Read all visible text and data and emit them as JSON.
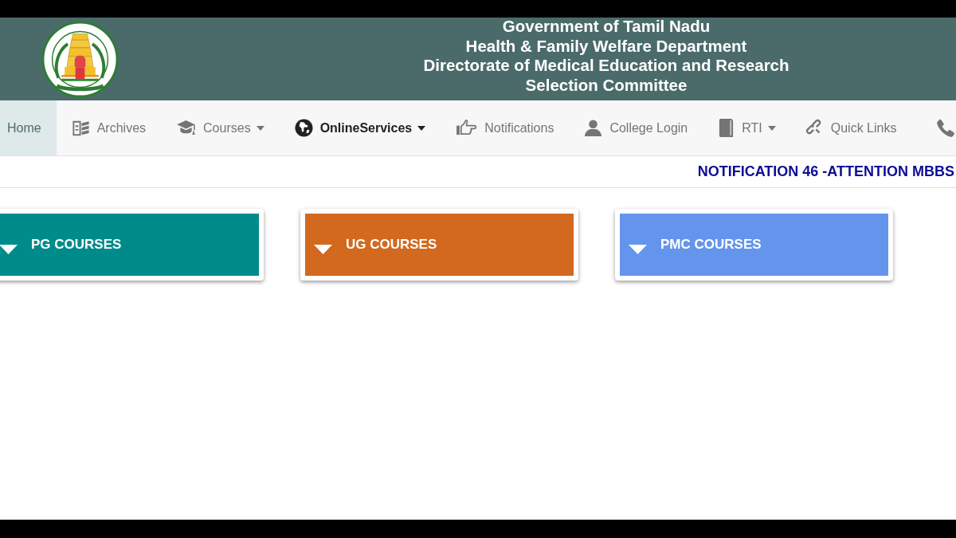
{
  "header": {
    "title_lines": [
      "Government of Tamil Nadu",
      "Health & Family Welfare Department",
      "Directorate of Medical Education and Research",
      "Selection Committee"
    ]
  },
  "nav": {
    "items": [
      {
        "label": "Home",
        "selected": true,
        "highlighted": false,
        "dropdown": false
      },
      {
        "label": "Archives",
        "selected": false,
        "highlighted": false,
        "dropdown": false
      },
      {
        "label": "Courses",
        "selected": false,
        "highlighted": false,
        "dropdown": true
      },
      {
        "label": "OnlineServices",
        "selected": false,
        "highlighted": true,
        "dropdown": true
      },
      {
        "label": "Notifications",
        "selected": false,
        "highlighted": false,
        "dropdown": false
      },
      {
        "label": "College Login",
        "selected": false,
        "highlighted": false,
        "dropdown": false
      },
      {
        "label": "RTI",
        "selected": false,
        "highlighted": false,
        "dropdown": true
      },
      {
        "label": "Quick Links",
        "selected": false,
        "highlighted": false,
        "dropdown": false
      },
      {
        "selected": false,
        "highlighted": false,
        "dropdown": false
      }
    ]
  },
  "notification_ticker": {
    "text": "NOTIFICATION 46 -ATTENTION MBBS"
  },
  "course_panels": [
    {
      "title": "PG COURSES",
      "color": "#008b8b"
    },
    {
      "title": "UG COURSES",
      "color": "#d2691e"
    },
    {
      "title": "PMC COURSES",
      "color": "#6495ed"
    }
  ]
}
